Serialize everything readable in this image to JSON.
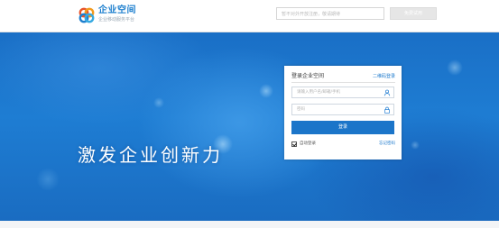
{
  "header": {
    "brand_title": "企业空间",
    "brand_subtitle": "企业移动服务平台",
    "search_placeholder": "暂不对外开放注册，敬请期待",
    "action_label": "免费试用",
    "logo_icon": "company-logo-icon"
  },
  "banner": {
    "slogan": "激发企业创新力"
  },
  "login": {
    "title": "登录企业空间",
    "qr_login": "二维码登录",
    "username_placeholder": "请输入用户名/邮箱/手机",
    "password_placeholder": "密码",
    "submit_label": "登录",
    "remember_label": "自动登录",
    "remember_checked": true,
    "forgot_label": "忘记密码",
    "user_icon": "user-icon",
    "lock_icon": "lock-icon"
  },
  "colors": {
    "brand_blue": "#1b75c9",
    "banner_blue": "#1e7dd3",
    "link_blue": "#1b78cc"
  }
}
